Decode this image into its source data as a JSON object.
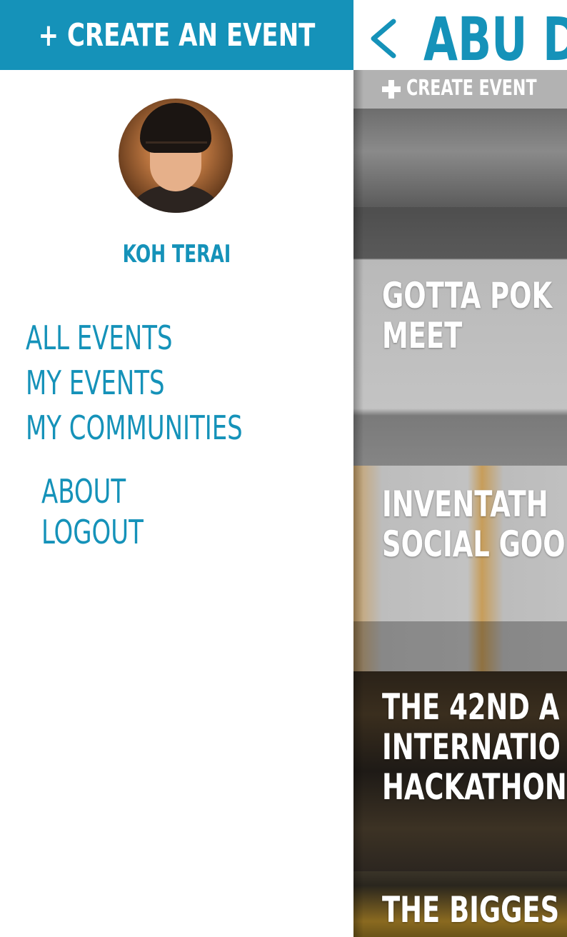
{
  "drawer": {
    "create_button_label": "+ CREATE AN EVENT",
    "user_name": "KOH TERAI",
    "menu_primary": [
      "ALL EVENTS",
      "MY EVENTS",
      "MY COMMUNITIES"
    ],
    "menu_secondary": [
      "ABOUT",
      "LOGOUT"
    ]
  },
  "main": {
    "title": "ABU D",
    "create_event_label": "CREATE EVENT",
    "events": [
      {
        "title_lines": [
          "GOTTA POK",
          "MEET"
        ]
      },
      {
        "title_lines": [
          "INVENTATH",
          "SOCIAL GOO"
        ]
      },
      {
        "title_lines": [
          "THE 42ND A",
          "INTERNATIO",
          "HACKATHON"
        ]
      },
      {
        "title_lines": [
          "THE BIGGES"
        ]
      }
    ]
  },
  "colors": {
    "accent": "#1592b9",
    "sub_bar": "#b2b2b2",
    "white": "#ffffff"
  },
  "icons": {
    "back": "chevron-left-icon",
    "create": "plus-icon",
    "avatar": "user-avatar"
  }
}
